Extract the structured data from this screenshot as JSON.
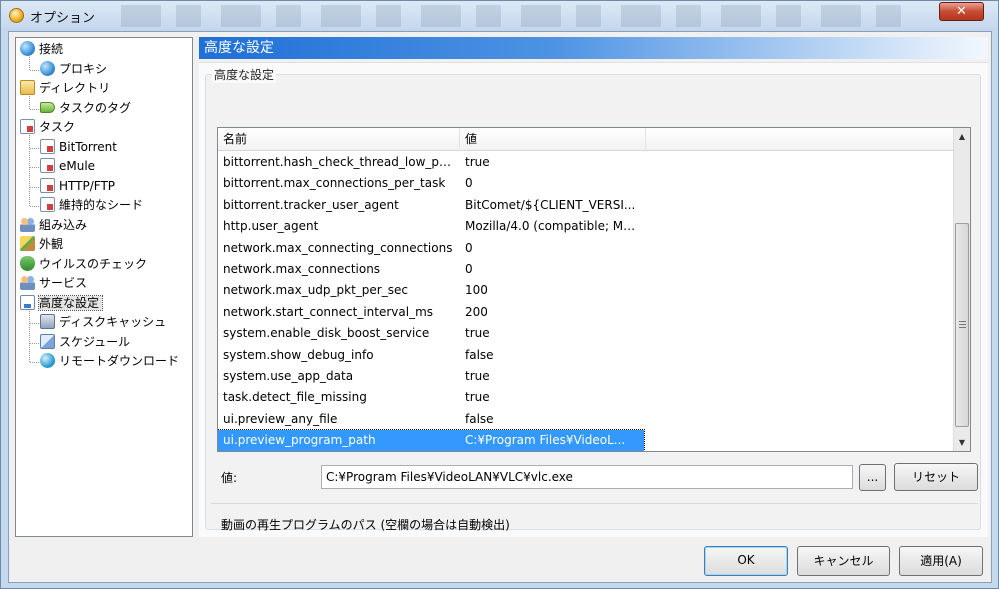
{
  "window": {
    "title": "オプション",
    "close_label": "✕"
  },
  "tree": {
    "items": [
      {
        "label": "接続",
        "icon": "globe-icon"
      },
      {
        "label": "プロキシ",
        "icon": "globe-icon"
      },
      {
        "label": "ディレクトリ",
        "icon": "folder-icon"
      },
      {
        "label": "タスクのタグ",
        "icon": "tag-icon"
      },
      {
        "label": "タスク",
        "icon": "task-icon"
      },
      {
        "label": "BitTorrent",
        "icon": "task-icon"
      },
      {
        "label": "eMule",
        "icon": "task-icon"
      },
      {
        "label": "HTTP/FTP",
        "icon": "task-icon"
      },
      {
        "label": "維持的なシード",
        "icon": "task-icon"
      },
      {
        "label": "組み込み",
        "icon": "people-icon"
      },
      {
        "label": "外観",
        "icon": "brush-icon"
      },
      {
        "label": "ウイルスのチェック",
        "icon": "shield-icon"
      },
      {
        "label": "サービス",
        "icon": "people-icon"
      },
      {
        "label": "高度な設定",
        "icon": "advanced-icon"
      },
      {
        "label": "ディスクキャッシュ",
        "icon": "disk-icon"
      },
      {
        "label": "スケジュール",
        "icon": "schedule-icon"
      },
      {
        "label": "リモートダウンロード",
        "icon": "remote-icon"
      }
    ],
    "selected": "高度な設定"
  },
  "panel": {
    "header": "高度な設定",
    "group_label": "高度な設定",
    "columns": [
      "名前",
      "値"
    ],
    "rows": [
      {
        "name": "bittorrent.hash_check_thread_low_pri...",
        "value": "true"
      },
      {
        "name": "bittorrent.max_connections_per_task",
        "value": "0"
      },
      {
        "name": "bittorrent.tracker_user_agent",
        "value": "BitComet/${CLIENT_VERSI..."
      },
      {
        "name": "http.user_agent",
        "value": "Mozilla/4.0 (compatible; MS..."
      },
      {
        "name": "network.max_connecting_connections",
        "value": "0"
      },
      {
        "name": "network.max_connections",
        "value": "0"
      },
      {
        "name": "network.max_udp_pkt_per_sec",
        "value": "100"
      },
      {
        "name": "network.start_connect_interval_ms",
        "value": "200"
      },
      {
        "name": "system.enable_disk_boost_service",
        "value": "true"
      },
      {
        "name": "system.show_debug_info",
        "value": "false"
      },
      {
        "name": "system.use_app_data",
        "value": "true"
      },
      {
        "name": "task.detect_file_missing",
        "value": "true"
      },
      {
        "name": "ui.preview_any_file",
        "value": "false"
      },
      {
        "name": "ui.preview_program_path",
        "value": "C:¥Program Files¥VideoL..."
      }
    ],
    "selected_row": "ui.preview_program_path",
    "value_label": "値:",
    "value_text": "C:¥Program Files¥VideoLAN¥VLC¥vlc.exe",
    "browse_label": "...",
    "reset_label": "リセット",
    "description": "動画の再生プログラムのパス (空欄の場合は自動検出)"
  },
  "buttons": {
    "ok": "OK",
    "cancel": "キャンセル",
    "apply": "適用(A)"
  }
}
